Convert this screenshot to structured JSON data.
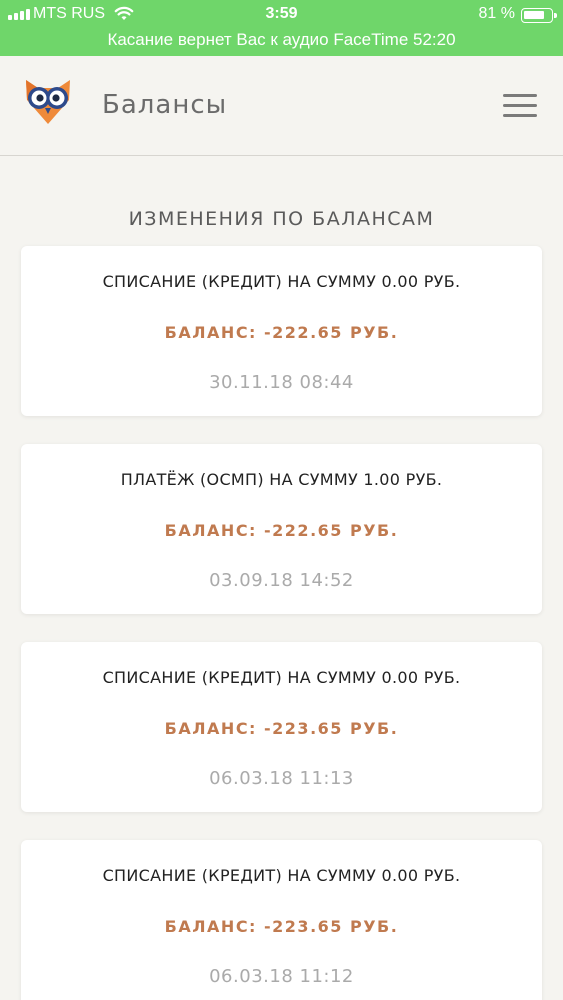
{
  "status_bar": {
    "carrier": "MTS RUS",
    "time": "3:59",
    "battery_percent": "81 %",
    "battery_level": 0.81,
    "banner": "Касание вернет Вас к аудио FaceTime 52:20",
    "color": "#6fd66a"
  },
  "header": {
    "title": "Балансы",
    "logo_icon": "owl-logo-icon",
    "menu_icon": "hamburger-menu-icon"
  },
  "section_title": "ИЗМЕНЕНИЯ ПО БАЛАНСАМ",
  "accent_color": "#c07a4f",
  "transactions": [
    {
      "description": "СПИСАНИЕ (КРЕДИТ) НА СУММУ 0.00 РУБ.",
      "balance": "БАЛАНС: -222.65 РУБ.",
      "date": "30.11.18 08:44"
    },
    {
      "description": "ПЛАТЁЖ (ОСМП) НА СУММУ 1.00 РУБ.",
      "balance": "БАЛАНС: -222.65 РУБ.",
      "date": "03.09.18 14:52"
    },
    {
      "description": "СПИСАНИЕ (КРЕДИТ) НА СУММУ 0.00 РУБ.",
      "balance": "БАЛАНС: -223.65 РУБ.",
      "date": "06.03.18 11:13"
    },
    {
      "description": "СПИСАНИЕ (КРЕДИТ) НА СУММУ 0.00 РУБ.",
      "balance": "БАЛАНС: -223.65 РУБ.",
      "date": "06.03.18 11:12"
    }
  ]
}
